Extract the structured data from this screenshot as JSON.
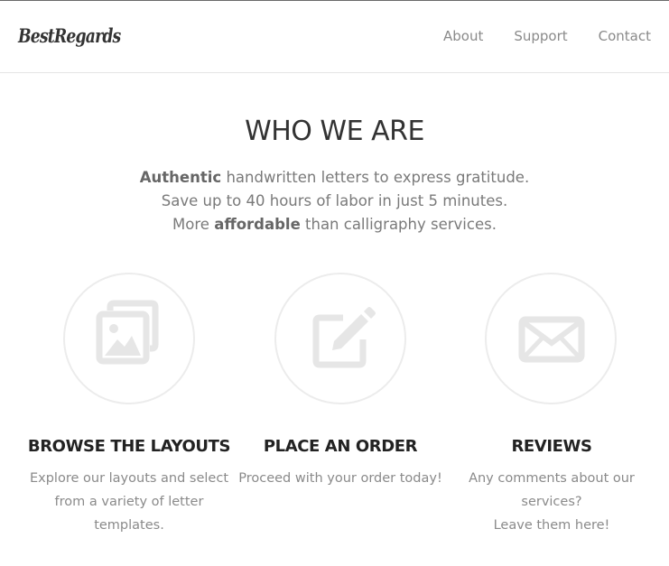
{
  "brand": {
    "logo_text": "BestRegards"
  },
  "nav": {
    "items": [
      "About",
      "Support",
      "Contact"
    ]
  },
  "hero": {
    "title": "WHO WE ARE",
    "line1_bold": "Authentic",
    "line1_rest": " handwritten letters to express gratitude.",
    "line2": "Save up to 40 hours of labor in just 5 minutes.",
    "line3_start": "More ",
    "line3_bold": "affordable",
    "line3_rest": " than calligraphy services."
  },
  "features": [
    {
      "icon": "image-gallery-icon",
      "title": "BROWSE THE LAYOUTS",
      "lines": [
        "Explore our layouts and select",
        "from a variety of letter",
        "templates."
      ]
    },
    {
      "icon": "edit-icon",
      "title": "PLACE AN ORDER",
      "lines": [
        "Proceed with your order today!"
      ]
    },
    {
      "icon": "envelope-icon",
      "title": "REVIEWS",
      "lines": [
        "Any comments about our",
        "services?",
        "Leave them here!"
      ]
    }
  ],
  "colors": {
    "icon": "#e6e6e6",
    "circle_border": "#ececec",
    "heading": "#222222",
    "muted_text": "#8a8a8a"
  }
}
